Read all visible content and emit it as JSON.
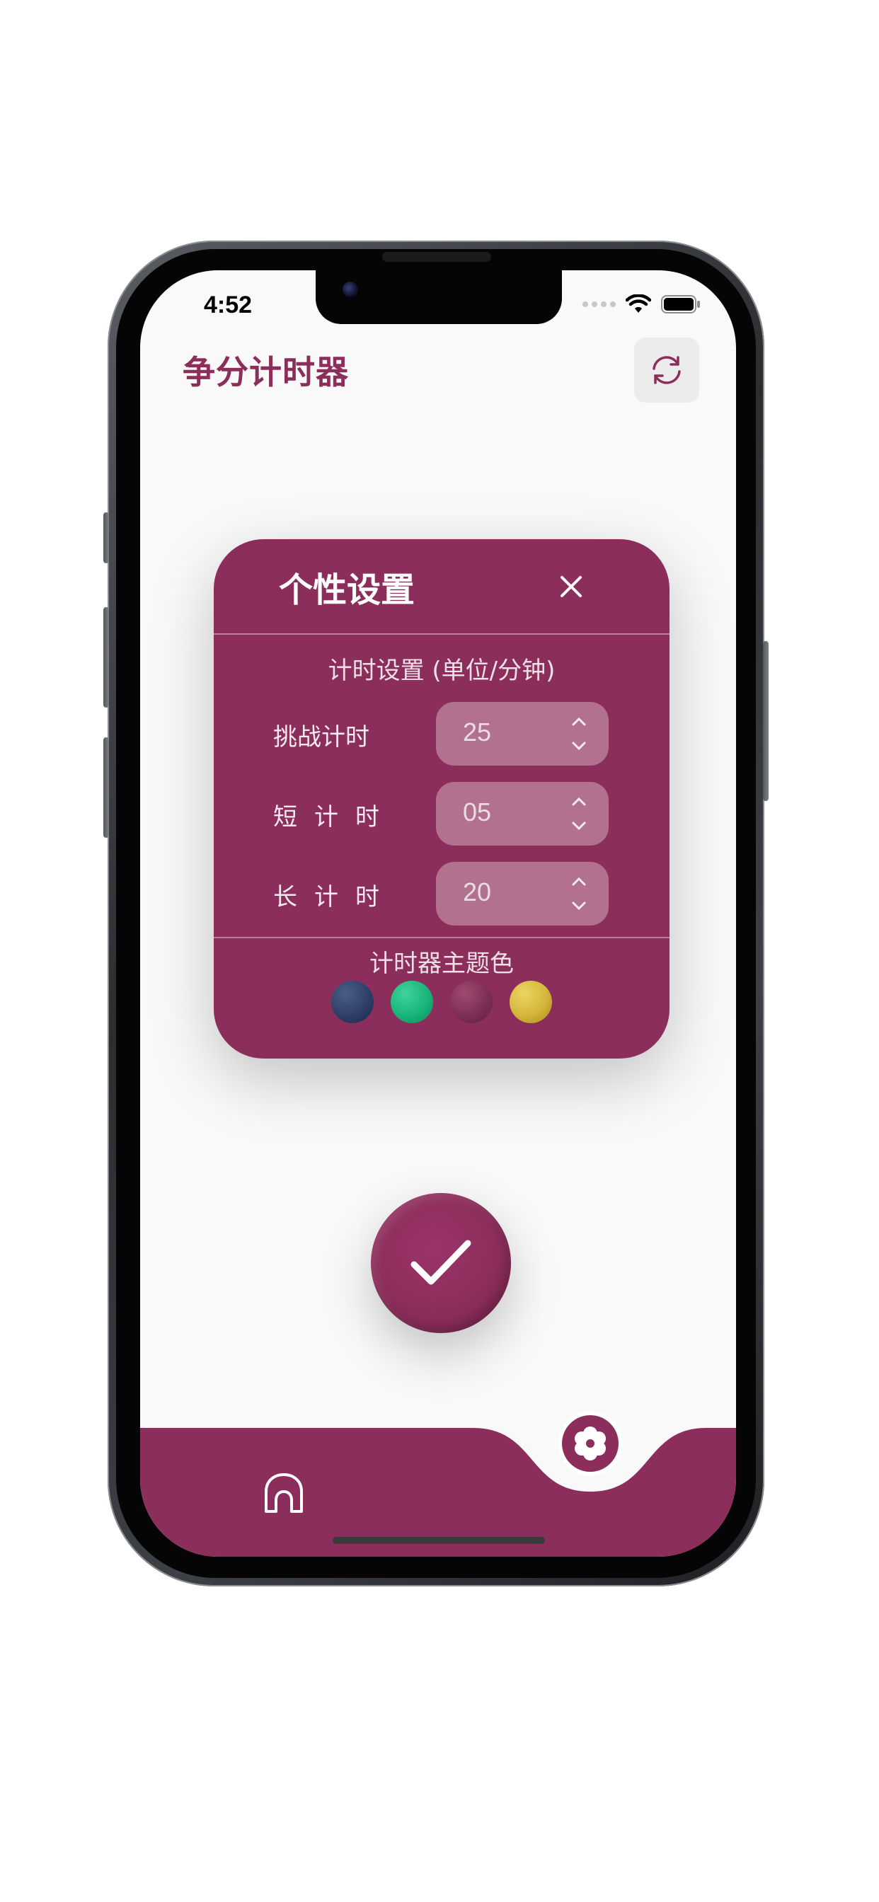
{
  "theme": {
    "accent": "#8c2e5b",
    "card_text": "#ffffff",
    "screen_background": "#f9f9f9"
  },
  "status_bar": {
    "time": "4:52",
    "wifi_icon": "wifi-icon",
    "battery_icon": "battery-icon"
  },
  "header": {
    "title": "争分计时器",
    "reset_icon": "refresh-icon"
  },
  "settings": {
    "title": "个性设置",
    "close_icon": "close-icon",
    "timer_section_label": "计时设置 (单位/分钟)",
    "timers": [
      {
        "label": "挑战计时",
        "value": "25"
      },
      {
        "label": "短计时",
        "value": "05"
      },
      {
        "label": "长计时",
        "value": "20"
      }
    ],
    "theme_section_label": "计时器主题色",
    "theme_colors": [
      {
        "name": "navy",
        "color": "#2e3f68"
      },
      {
        "name": "green",
        "color": "#19b57a"
      },
      {
        "name": "plum",
        "color": "#8c2e5b"
      },
      {
        "name": "gold",
        "color": "#d4b63a"
      }
    ]
  },
  "confirm": {
    "icon": "check-icon"
  },
  "bottom_nav": {
    "home_icon": "home-icon",
    "settings_icon": "flower-settings-icon",
    "active_tab": "settings"
  }
}
